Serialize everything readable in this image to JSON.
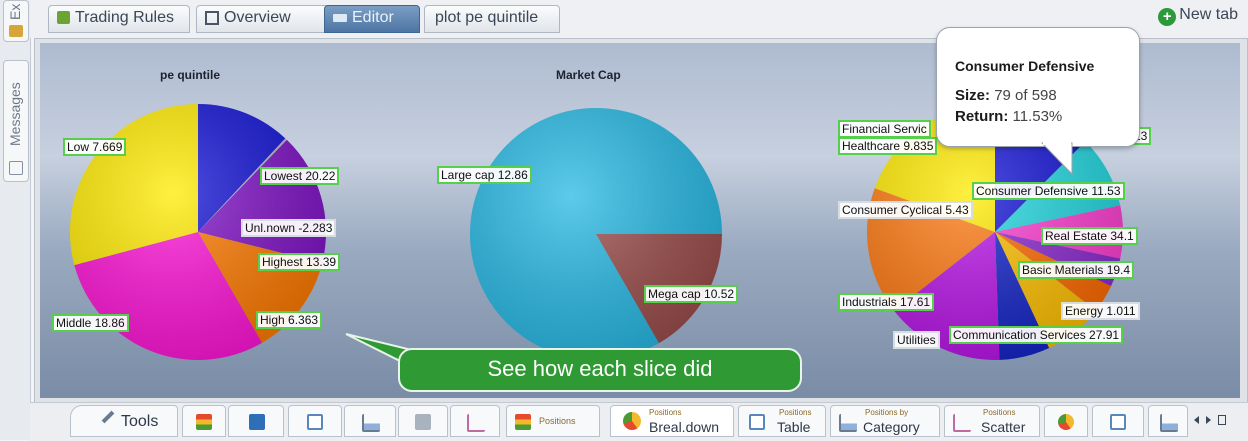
{
  "rail": {
    "tab1": "Ex",
    "tab2": "Messages"
  },
  "tabs": [
    {
      "label": "Trading Rules",
      "active": false
    },
    {
      "label": "Overview",
      "active": false
    },
    {
      "label": "Editor",
      "active": true
    },
    {
      "label": "plot pe quintile",
      "active": false
    }
  ],
  "new_tab": "New tab",
  "chart_data": [
    {
      "type": "pie",
      "title": "pe quintile",
      "slices": [
        {
          "label": "Lowest",
          "value": 20.22,
          "color": "#1313d6"
        },
        {
          "label": "Unknown",
          "value": -2.283,
          "color": "#b0b8c6"
        },
        {
          "label": "Highest",
          "value": 13.39,
          "color": "#7f12c6"
        },
        {
          "label": "High",
          "value": 6.363,
          "color": "#ff7a00"
        },
        {
          "label": "Middle",
          "value": 18.86,
          "color": "#ff15d7"
        },
        {
          "label": "Low",
          "value": 7.669,
          "color": "#ffea00"
        }
      ]
    },
    {
      "type": "pie",
      "title": "Market Cap",
      "slices": [
        {
          "label": "Large cap",
          "value": 12.86,
          "color": "#27b9e4"
        },
        {
          "label": "Mega cap",
          "value": 10.52,
          "color": "#9b4d4b"
        }
      ]
    },
    {
      "type": "pie",
      "title": "",
      "slices": [
        {
          "label": "Financial Services",
          "value": 13,
          "color": "#1313d6"
        },
        {
          "label": "Consumer Defensive",
          "value": 11.53,
          "color": "#22d7e0"
        },
        {
          "label": "Real Estate",
          "value": 34.1,
          "color": "#ff3fd2"
        },
        {
          "label": "Basic Materials",
          "value": 19.4,
          "color": "#8c2ad0"
        },
        {
          "label": "Energy",
          "value": 1.011,
          "color": "#ff6a00"
        },
        {
          "label": "Communication Services",
          "value": 27.91,
          "color": "#ffc000"
        },
        {
          "label": "Utilities",
          "value": null,
          "color": "#1424c8"
        },
        {
          "label": "Industrials",
          "value": 17.61,
          "color": "#b915e8"
        },
        {
          "label": "Consumer Cyclical",
          "value": 5.43,
          "color": "#ff7a12"
        },
        {
          "label": "Healthcare",
          "value": 9.835,
          "color": "#ffea00"
        }
      ]
    }
  ],
  "labels": {
    "low": "Low 7.669",
    "lowest": "Lowest 20.22",
    "unknown": "Unl.nown -2.283",
    "highest": "Highest 13.39",
    "middle": "Middle 18.86",
    "high": "High 6.363",
    "large_cap": "Large cap 12.86",
    "mega_cap": "Mega cap 10.52",
    "financial": "Financial Servic",
    "healthcare": "Healthcare 9.835",
    "fin_value": "13",
    "consumer_defensive": "Consumer Defensive 11.53",
    "consumer_cyclical": "Consumer Cyclical 5.43",
    "real_estate": "Real Estate 34.1",
    "basic_materials": "Basic Materials 19.4",
    "industrials": "Industrials 17.61",
    "energy": "Energy 1.011",
    "utilities": "Utilities",
    "communication": "Communication Services 27.91"
  },
  "tooltip": {
    "title": "Consumer Defensive",
    "size_label": "Size:",
    "size_value": "79 of 598",
    "return_label": "Return:",
    "return_value": "11.53%"
  },
  "callout": "See how each slice did",
  "bottom": {
    "tools": "Tools",
    "positions_small": "Positions",
    "breakdown_small": "Positions",
    "breakdown": "Breal.down",
    "table_small": "Positions",
    "table": "Table",
    "category_small": "Positions by",
    "category": "Category",
    "scatter_small": "Positions",
    "scatter": "Scatter"
  }
}
